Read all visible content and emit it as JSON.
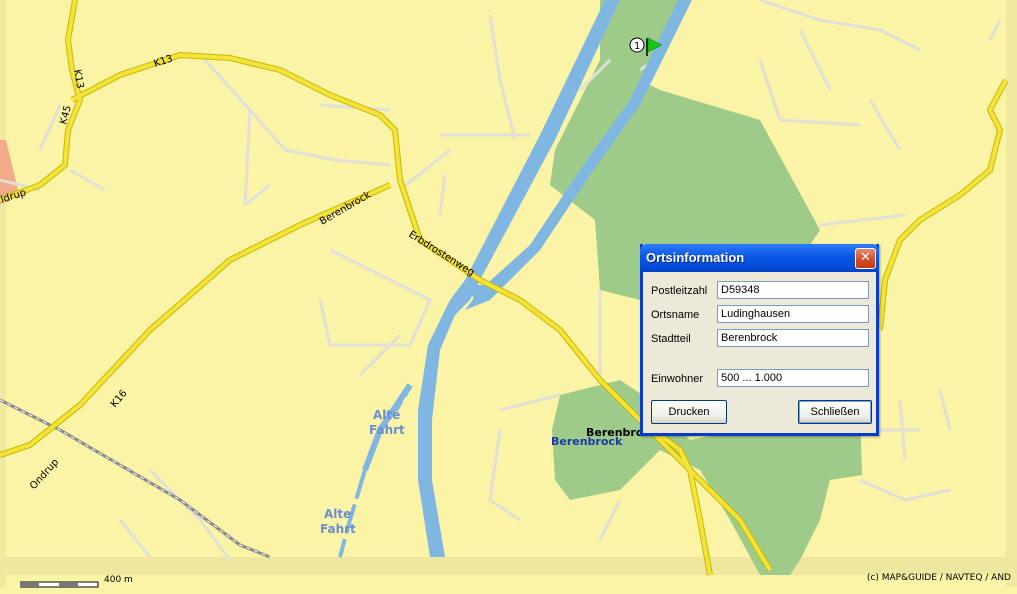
{
  "map": {
    "road_labels": {
      "k13_top": "K13",
      "k13_left": "K13",
      "k45": "K45",
      "edrup": "ldrup",
      "berenbrock_road": "Berenbrock",
      "erbdrostenweg": "Erbdrostenweg",
      "k16": "K16",
      "ondrup": "Ondrup"
    },
    "water_labels": {
      "alte_fahrt_1_line1": "Alte",
      "alte_fahrt_1_line2": "Fahrt",
      "alte_fahrt_2_line1": "Alte",
      "alte_fahrt_2_line2": "Fahrt"
    },
    "place_labels": {
      "berenbrock_black": "Berenbrock",
      "berenbrock_blue": "Berenbrock"
    },
    "marker_number": "1",
    "scale_label": "400 m",
    "copyright": "(c) MAP&GUIDE / NAVTEQ / AND",
    "colors": {
      "land": "#fbf4a6",
      "forest": "#9fcb8a",
      "water": "#7fb7e2",
      "main_road": "#f4e33a",
      "minor_road": "#e2e2d8",
      "marker_flag": "#18c418"
    }
  },
  "dialog": {
    "title": "Ortsinformation",
    "close_symbol": "✕",
    "fields": {
      "postleitzahl_label": "Postleitzahl",
      "postleitzahl_value": "D59348",
      "ortsname_label": "Ortsname",
      "ortsname_value": "Ludinghausen",
      "stadtteil_label": "Stadtteil",
      "stadtteil_value": "Berenbrock",
      "einwohner_label": "Einwohner",
      "einwohner_value": "500 ... 1.000"
    },
    "buttons": {
      "print": "Drucken",
      "close": "Schließen"
    }
  }
}
